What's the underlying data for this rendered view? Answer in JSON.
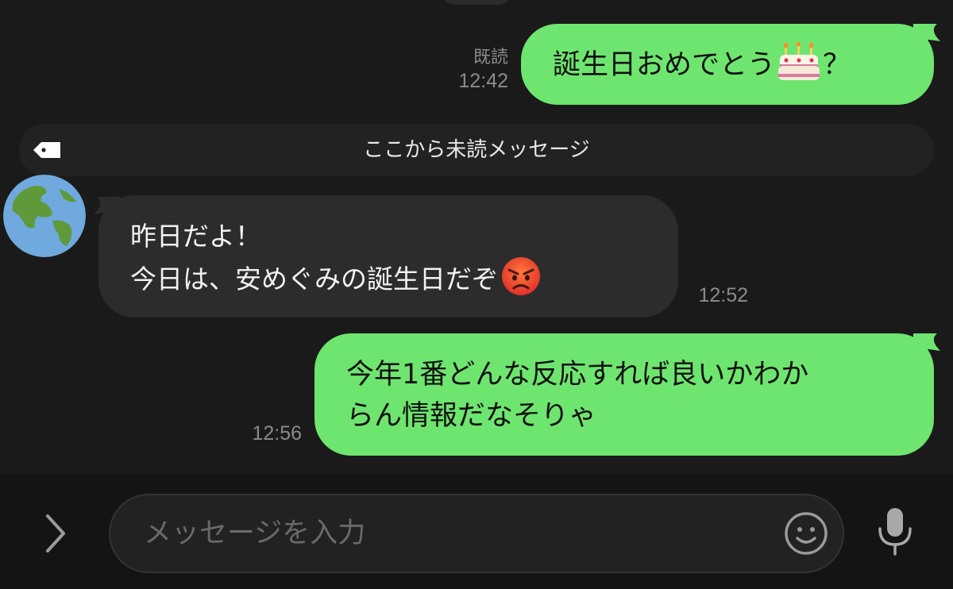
{
  "messages": [
    {
      "direction": "out",
      "text": "誕生日おめでとう",
      "suffix": "？",
      "read_label": "既読",
      "time": "12:42"
    },
    {
      "direction": "in",
      "line1": "昨日だよ！",
      "line2": "今日は、安めぐみの誕生日だぞ",
      "time": "12:52"
    },
    {
      "direction": "out",
      "line1": "今年1番どんな反応すれば良いかわか",
      "line2": "らん情報だなそりゃ",
      "time": "12:56"
    }
  ],
  "unread": {
    "label": "ここから未読メッセージ"
  },
  "composer": {
    "placeholder": "メッセージを入力"
  },
  "icons": {
    "expand": "chevron-right-icon",
    "tag": "tag-icon",
    "avatar": "earth-globe-icon",
    "cake": "birthday-cake-emoji",
    "angry": "angry-face-emoji",
    "emoji": "smiley-icon",
    "mic": "microphone-icon"
  },
  "colors": {
    "outgoing_bubble": "#6ee56f",
    "incoming_bubble": "#2c2c2c",
    "background": "#1a1a1a"
  }
}
